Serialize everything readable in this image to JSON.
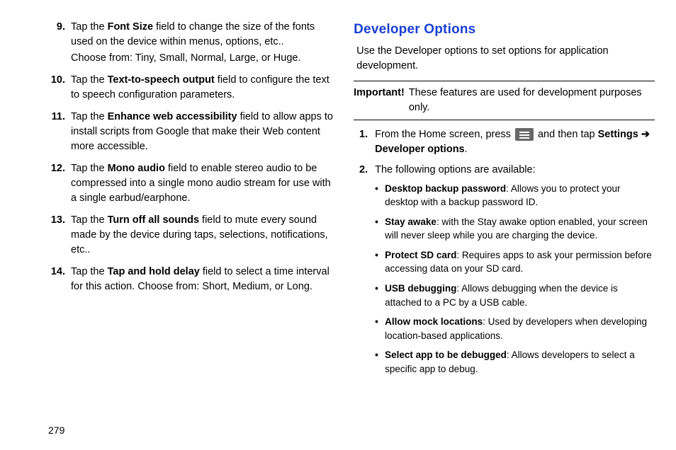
{
  "pageNumber": "279",
  "left": {
    "items": [
      {
        "num": "9.",
        "html": "Tap the <b>Font Size</b> field to change the size of the fonts used on the device within menus, options, etc..",
        "extra": "Choose from: Tiny, Small, Normal, Large, or Huge."
      },
      {
        "num": "10.",
        "html": "Tap the <b>Text-to-speech output</b> field to configure the text to speech configuration parameters."
      },
      {
        "num": "11.",
        "html": "Tap the <b>Enhance web accessibility</b> field to allow apps to install scripts from Google that make their Web content more accessible."
      },
      {
        "num": "12.",
        "html": "Tap the <b>Mono audio</b> field to enable stereo audio to be compressed into a single mono audio stream for use with a single earbud/earphone."
      },
      {
        "num": "13.",
        "html": "Tap the <b>Turn off all sounds</b> field to mute every sound made by the device during taps, selections, notifications, etc.."
      },
      {
        "num": "14.",
        "html": "Tap the <b>Tap and hold delay</b> field to select a time interval for this action. Choose from: Short, Medium, or Long."
      }
    ]
  },
  "right": {
    "title": "Developer Options",
    "intro": "Use the Developer options to set options for application development.",
    "importantLabel": "Important!",
    "importantText": "These features are used for development purposes only.",
    "steps": [
      {
        "num": "1.",
        "pre": "From the Home screen, press ",
        "post": " and then tap <b>Settings</b> <span class='arrow'>➔</span> <b>Developer options</b>."
      },
      {
        "num": "2.",
        "html": "The following options are available:"
      }
    ],
    "bullets": [
      {
        "html": "<b>Desktop backup password</b>: Allows you to protect your desktop with a backup password ID."
      },
      {
        "html": "<b>Stay awake</b>: with the Stay awake option enabled, your screen will never sleep while you are charging the device."
      },
      {
        "html": "<b>Protect SD card</b>: Requires apps to ask your permission before accessing data on your SD card."
      },
      {
        "html": "<b>USB debugging</b>: Allows debugging when the device is attached to a PC by a USB cable."
      },
      {
        "html": "<b>Allow mock locations</b>: Used by developers when developing location-based applications."
      },
      {
        "html": "<b>Select app to be debugged</b>: Allows developers to select a specific app to debug."
      }
    ]
  }
}
